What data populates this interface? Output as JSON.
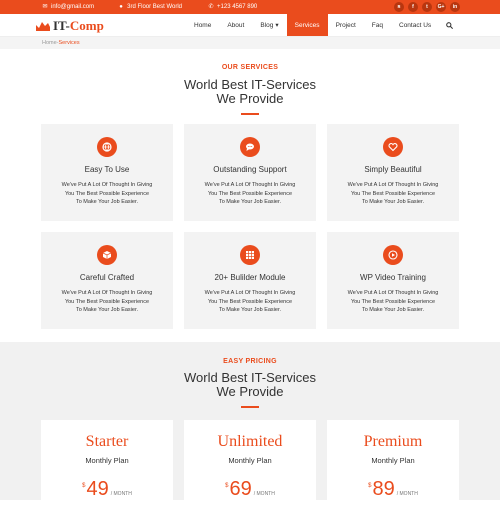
{
  "topbar": {
    "email": "info@gmail.com",
    "address": "3rd Floor Best World",
    "phone": "+123 4567 890",
    "social": [
      "rss-icon",
      "facebook-icon",
      "twitter-icon",
      "google-plus-icon",
      "linkedin-icon"
    ],
    "social_glyphs": [
      "ʀ",
      "f",
      "t",
      "G+",
      "in"
    ]
  },
  "logo": {
    "text_a": "IT-",
    "text_b": "Comp"
  },
  "menu": [
    "Home",
    "About",
    "Blog",
    "Services",
    "Project",
    "Faq",
    "Contact Us"
  ],
  "menu_active": "Services",
  "blog_caret": "▾",
  "breadcrumb": {
    "home": "Home",
    "sep": " - ",
    "current": "Services"
  },
  "services": {
    "kicker": "OUR SERVICES",
    "title_line1": "World Best IT-Services",
    "title_line2": "We Provide",
    "items": [
      {
        "title": "Easy To Use",
        "icon": "globe-icon",
        "desc": [
          "We've Put A Lot Of Thought In Giving",
          "You The Best Possible Experience",
          "To Make Your Job Easier."
        ]
      },
      {
        "title": "Outstanding Support",
        "icon": "chat-icon",
        "desc": [
          "We've Put A Lot Of Thought In Giving",
          "You The Best Possible Experience",
          "To Make Your Job Easier."
        ]
      },
      {
        "title": "Simply Beautiful",
        "icon": "heart-icon",
        "desc": [
          "We've Put A Lot Of Thought In Giving",
          "You The Best Possible Experience",
          "To Make Your Job Easier."
        ]
      },
      {
        "title": "Careful Crafted",
        "icon": "cube-icon",
        "desc": [
          "We've Put A Lot Of Thought In Giving",
          "You The Best Possible Experience",
          "To Make Your Job Easier."
        ]
      },
      {
        "title": "20+ Bulilder Module",
        "icon": "grid-icon",
        "desc": [
          "We've Put A Lot Of Thought In Giving",
          "You The Best Possible Experience",
          "To Make Your Job Easier."
        ]
      },
      {
        "title": "WP Video Training",
        "icon": "play-icon",
        "desc": [
          "We've Put A Lot Of Thought In Giving",
          "You The Best Possible Experience",
          "To Make Your Job Easier."
        ]
      }
    ]
  },
  "pricing": {
    "kicker": "EASY PRICING",
    "title_line1": "World Best IT-Services",
    "title_line2": "We Provide",
    "plans": [
      {
        "name": "Starter",
        "period_label": "Monthly Plan",
        "currency": "$",
        "amount": "49",
        "per": "/ MONTH"
      },
      {
        "name": "Unlimited",
        "period_label": "Monthly Plan",
        "currency": "$",
        "amount": "69",
        "per": "/ MONTH"
      },
      {
        "name": "Premium",
        "period_label": "Monthly Plan",
        "currency": "$",
        "amount": "89",
        "per": "/ MONTH"
      }
    ]
  },
  "colors": {
    "accent": "#ea4c1d"
  }
}
